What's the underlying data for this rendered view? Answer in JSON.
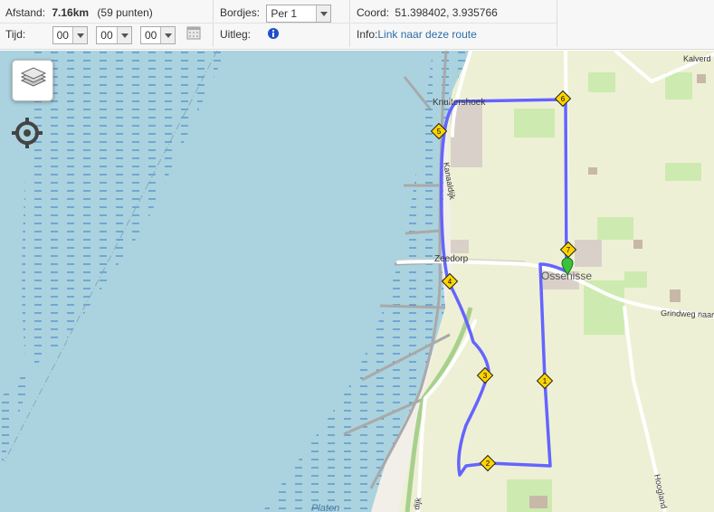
{
  "toolbar": {
    "distance_label": "Afstand:",
    "distance_value": "7.16km",
    "points_text": "(59 punten)",
    "time_label": "Tijd:",
    "hours": "00",
    "minutes": "00",
    "seconds": "00",
    "signs_label": "Bordjes:",
    "signs_value": "Per 1",
    "explain_label": "Uitleg:",
    "coord_label": "Coord:",
    "coord_value": "51.398402, 3.935766",
    "info_label": "Info:",
    "info_link": "Link naar deze route"
  },
  "map": {
    "place_labels": {
      "knuitershoek": "Knuitershoek",
      "zeedorp": "Zeedorp",
      "ossenisse": "Ossenisse",
      "kanaaldijk": "Kanaaldijk",
      "grindweg": "Grindweg naar",
      "hoogland": "Hoogland",
      "kalverd": "Kalverd",
      "platen": "Platen",
      "dijk": "dijk"
    },
    "route_markers": [
      "1",
      "2",
      "3",
      "4",
      "5",
      "6",
      "7"
    ],
    "colors": {
      "water": "#aad3df",
      "land": "#f2efe9",
      "farmland": "#eef0d5",
      "grass": "#cdebb0",
      "route": "#6464ff",
      "marker": "#ffd400",
      "start_pin": "#39c339"
    },
    "icons": [
      "layers-icon",
      "locate-icon",
      "calendar-icon",
      "info-icon"
    ]
  }
}
